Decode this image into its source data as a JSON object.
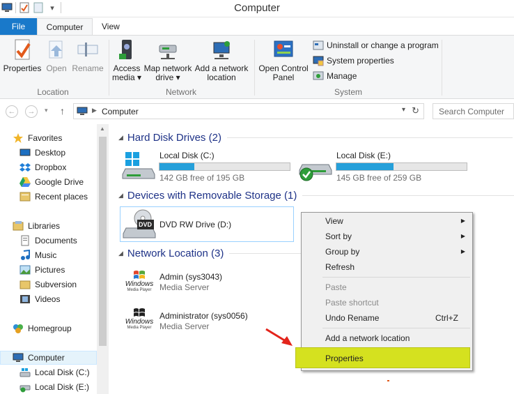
{
  "window": {
    "title": "Computer"
  },
  "tabs": {
    "file": "File",
    "computer": "Computer",
    "view": "View"
  },
  "ribbon": {
    "location": {
      "label": "Location",
      "properties": "Properties",
      "open": "Open",
      "rename": "Rename"
    },
    "network": {
      "label": "Network",
      "access_media_1": "Access",
      "access_media_2": "media ▾",
      "map_drive_1": "Map network",
      "map_drive_2": "drive ▾",
      "add_location_1": "Add a network",
      "add_location_2": "location"
    },
    "system": {
      "label": "System",
      "control_panel_1": "Open Control",
      "control_panel_2": "Panel",
      "uninstall": "Uninstall or change a program",
      "sys_props": "System properties",
      "manage": "Manage"
    }
  },
  "address": {
    "crumb": "Computer",
    "search_placeholder": "Search Computer"
  },
  "sidebar": {
    "favorites": "Favorites",
    "desktop": "Desktop",
    "dropbox": "Dropbox",
    "google_drive": "Google Drive",
    "recent": "Recent places",
    "libraries": "Libraries",
    "documents": "Documents",
    "music": "Music",
    "pictures": "Pictures",
    "subversion": "Subversion",
    "videos": "Videos",
    "homegroup": "Homegroup",
    "computer": "Computer",
    "local_c": "Local Disk (C:)",
    "local_e": "Local Disk (E:)"
  },
  "sections": {
    "hdd": "Hard Disk Drives (2)",
    "removable": "Devices with Removable Storage (1)",
    "network": "Network Location (3)"
  },
  "drives": [
    {
      "name": "Local Disk (C:)",
      "free": "142 GB free of 195 GB",
      "used_fraction": 0.27
    },
    {
      "name": "Local Disk (E:)",
      "free": "145 GB free of 259 GB",
      "used_fraction": 0.44
    }
  ],
  "dvd": {
    "name": "DVD RW Drive (D:)",
    "icon_text": "DVD"
  },
  "network_items": [
    {
      "name": "Admin (sys3043)",
      "type": "Media Server"
    },
    {
      "name": "Administrator (sys0056)",
      "type": "Media Server"
    }
  ],
  "wmp_logo": {
    "line1": "Windows",
    "line2": "Media Player"
  },
  "context_menu": {
    "view": "View",
    "sort_by": "Sort by",
    "group_by": "Group by",
    "refresh": "Refresh",
    "paste": "Paste",
    "paste_shortcut": "Paste shortcut",
    "undo_rename": "Undo Rename",
    "undo_shortcut": "Ctrl+Z",
    "add_network_location": "Add a network location",
    "properties": "Properties"
  },
  "colors": {
    "accent": "#1979ca",
    "highlight": "#d5e11f",
    "section_text": "#1e3287",
    "drive_fill": "#26a0da"
  }
}
